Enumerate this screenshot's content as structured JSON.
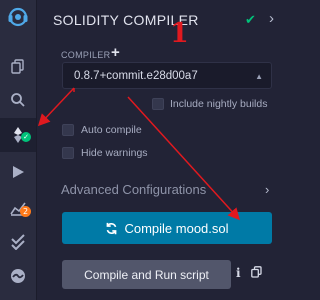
{
  "panel": {
    "title": "SOLIDITY COMPILER",
    "compiler_label": "COMPILER",
    "compiler_version": "0.8.7+commit.e28d00a7",
    "options": {
      "include_nightly": "Include nightly builds",
      "auto_compile": "Auto compile",
      "hide_warnings": "Hide warnings"
    },
    "advanced": "Advanced Configurations",
    "compile_button": "Compile mood.sol",
    "compile_run_button": "Compile and Run script"
  },
  "sidebar": {
    "items": [
      "file-explorer-icon",
      "search-icon",
      "solidity-compiler-icon",
      "deploy-run-icon",
      "analysis-icon",
      "tests-icon",
      "debugger-icon"
    ],
    "badge_count": "2"
  },
  "annotation": {
    "number": "1",
    "color": "#e0191f"
  },
  "colors": {
    "accent": "#007aa6",
    "success": "#00c37a",
    "badge": "#ff7a1a",
    "background": "#222336"
  }
}
